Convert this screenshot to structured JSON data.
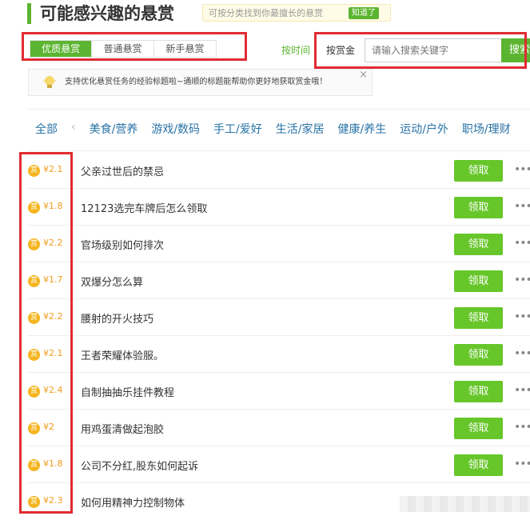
{
  "header": {
    "title": "可能感兴趣的悬赏",
    "hint": "可按分类找到你最擅长的悬赏",
    "hint_button": "知道了"
  },
  "tabs": [
    {
      "label": "优质悬赏",
      "active": true
    },
    {
      "label": "普通悬赏",
      "active": false
    },
    {
      "label": "新手悬赏",
      "active": false
    }
  ],
  "sort": {
    "time": "按时间",
    "reward": "按赏金"
  },
  "search": {
    "placeholder": "请输入搜索关键字",
    "button": "搜索"
  },
  "notice": {
    "text": "支持优化悬赏任务的经验标题啦~通顺的标题能帮助你更好地获取赏金哦！",
    "close": "×"
  },
  "categories": {
    "all": "全部",
    "arrow": "‹",
    "items": [
      "美食/营养",
      "游戏/数码",
      "手工/爱好",
      "生活/家居",
      "健康/养生",
      "运动/户外",
      "职场/理财"
    ]
  },
  "list": {
    "coin_label": "赏",
    "claim_label": "领取",
    "more_label": "•••",
    "items": [
      {
        "amount": "¥2.1",
        "title": "父亲过世后的禁忌"
      },
      {
        "amount": "¥1.8",
        "title": "12123选完车牌后怎么领取"
      },
      {
        "amount": "¥2.2",
        "title": "官场级别如何排次"
      },
      {
        "amount": "¥1.7",
        "title": "双爆分怎么算"
      },
      {
        "amount": "¥2.2",
        "title": "腰射的开火技巧"
      },
      {
        "amount": "¥2.1",
        "title": "王者荣耀体验服。"
      },
      {
        "amount": "¥2.4",
        "title": "自制抽抽乐挂件教程"
      },
      {
        "amount": "¥2",
        "title": "用鸡蛋清做起泡胶"
      },
      {
        "amount": "¥1.8",
        "title": "公司不分红,股东如何起诉"
      },
      {
        "amount": "¥2.3",
        "title": "如何用精神力控制物体"
      }
    ]
  },
  "colors": {
    "accent": "#5cb531",
    "claim": "#66c62a",
    "highlight": "#e02b32",
    "coin": "#f5b51f",
    "link": "#2873a6"
  }
}
